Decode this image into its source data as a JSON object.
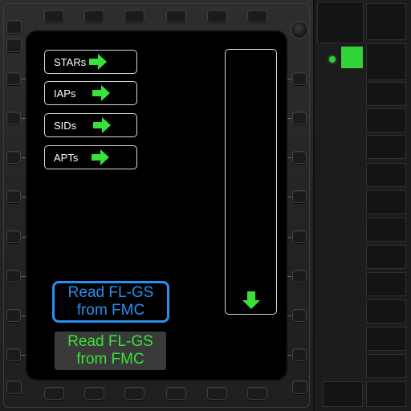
{
  "menu": {
    "items": [
      {
        "label": "STARs"
      },
      {
        "label": "IAPs"
      },
      {
        "label": "SIDs"
      },
      {
        "label": "APTs"
      }
    ]
  },
  "actions": {
    "read_blue": {
      "line1": "Read FL-GS",
      "line2": "from FMC"
    },
    "read_green": {
      "line1": "Read FL-GS",
      "line2": "from FMC"
    }
  },
  "icons": {
    "menu_arrow": "arrow-right-icon",
    "scroll_arrow": "arrow-down-icon"
  },
  "colors": {
    "accent_green": "#39e23a",
    "accent_blue": "#2b8ef0",
    "status_led": "#34c83a"
  }
}
